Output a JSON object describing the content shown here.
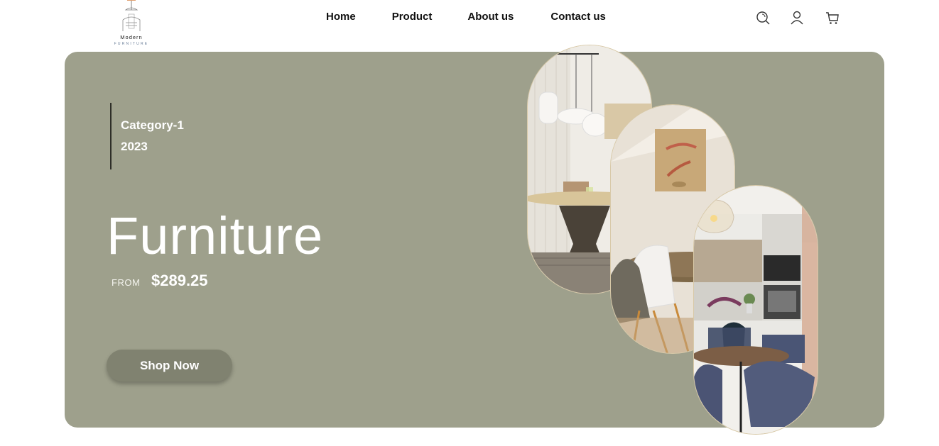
{
  "brand": {
    "name": "Modern",
    "sub": "FURNITURE",
    "logo_icon": "chair-lamp-logo-icon"
  },
  "nav": {
    "items": [
      {
        "label": "Home"
      },
      {
        "label": "Product"
      },
      {
        "label": "About us"
      },
      {
        "label": "Contact us"
      }
    ]
  },
  "header_icons": [
    "search-icon",
    "user-icon",
    "cart-icon"
  ],
  "hero": {
    "category": "Category-1",
    "year": "2023",
    "title": "Furniture",
    "from_label": "FROM",
    "price": "$289.25",
    "cta_label": "Shop Now",
    "images": [
      "pendant-lamp-table-photo",
      "dining-chair-painting-photo",
      "kitchen-dining-photo"
    ],
    "colors": {
      "hero_bg": "#9ea08c",
      "button_bg": "#808270",
      "text": "#ffffff"
    }
  }
}
